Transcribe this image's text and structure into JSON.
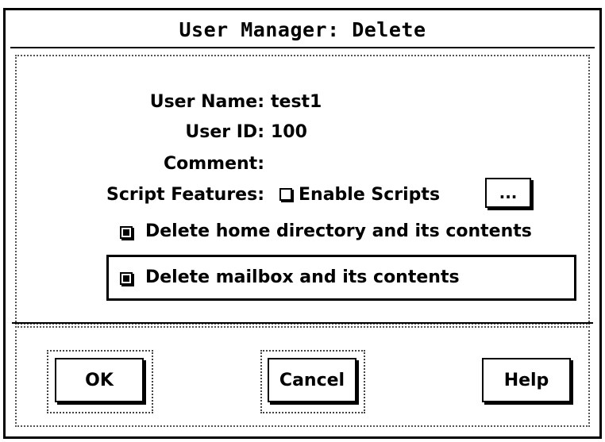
{
  "window": {
    "title": "User Manager: Delete"
  },
  "fields": {
    "user_name_label": "User Name:",
    "user_name_value": "test1",
    "user_id_label": "User ID:",
    "user_id_value": "100",
    "comment_label": "Comment:",
    "comment_value": "",
    "script_features_label": "Script Features:",
    "enable_scripts_label": "Enable Scripts",
    "enable_scripts_checked": false,
    "script_options_label": "..."
  },
  "options": {
    "delete_home_label": "Delete home directory and its contents",
    "delete_home_checked": true,
    "delete_mailbox_label": "Delete mailbox and its contents",
    "delete_mailbox_checked": true
  },
  "buttons": {
    "ok": "OK",
    "cancel": "Cancel",
    "help": "Help"
  }
}
